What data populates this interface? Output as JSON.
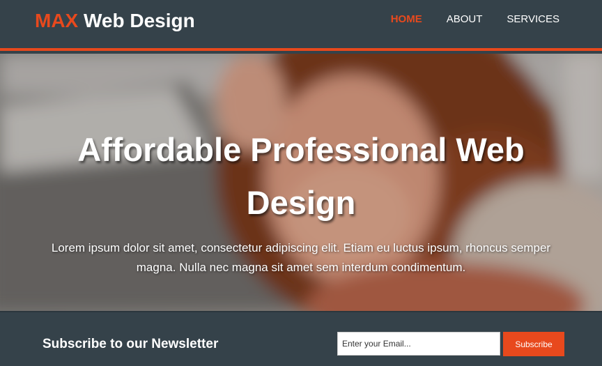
{
  "header": {
    "logo_highlight": "MAX",
    "logo_rest": " Web Design",
    "nav": [
      {
        "label": "HOME",
        "active": true
      },
      {
        "label": "ABOUT",
        "active": false
      },
      {
        "label": "SERVICES",
        "active": false
      }
    ]
  },
  "showcase": {
    "title": "Affordable Professional Web Design",
    "text": "Lorem ipsum dolor sit amet, consectetur adipiscing elit. Etiam eu luctus ipsum, rhoncus semper magna. Nulla nec magna sit amet sem interdum condimentum."
  },
  "newsletter": {
    "title": "Subscribe to our Newsletter",
    "email_placeholder": "Enter your Email...",
    "button_label": "Subscribe"
  },
  "colors": {
    "accent": "#e8491d",
    "dark": "#35424a"
  }
}
